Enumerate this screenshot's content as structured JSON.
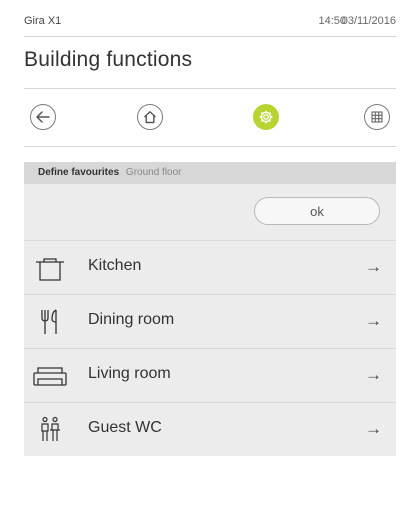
{
  "status": {
    "device": "Gira X1",
    "time": "14:50",
    "date": "03/11/2016"
  },
  "page_title": "Building functions",
  "nav": {
    "back_icon": "arrow-left-icon",
    "home_icon": "house-icon",
    "settings_icon": "gear-icon",
    "grid_icon": "grid-icon",
    "active_color": "#b8d430"
  },
  "section": {
    "label": "Define favourites",
    "sub": "Ground floor"
  },
  "ok_label": "ok",
  "rooms": [
    {
      "label": "Kitchen",
      "icon": "cooking-pot-icon"
    },
    {
      "label": "Dining room",
      "icon": "cutlery-icon"
    },
    {
      "label": "Living room",
      "icon": "sofa-icon"
    },
    {
      "label": "Guest WC",
      "icon": "wc-icon"
    }
  ],
  "arrow_glyph": "→"
}
